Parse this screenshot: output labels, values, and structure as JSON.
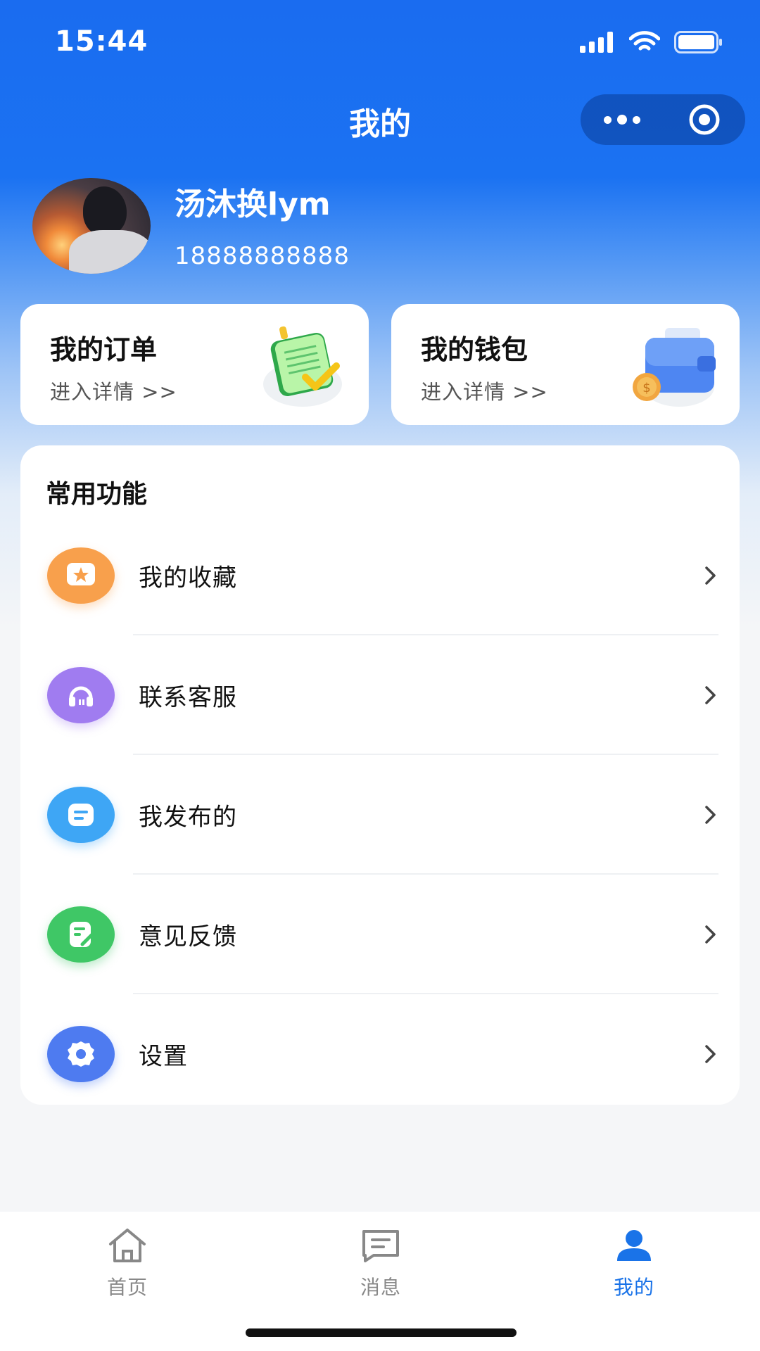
{
  "status": {
    "time": "15:44"
  },
  "nav": {
    "title": "我的"
  },
  "profile": {
    "name": "汤沐换lym",
    "phone": "18888888888"
  },
  "cards": [
    {
      "title": "我的订单",
      "subtitle": "进入详情 >>",
      "icon": "notepad-check-icon"
    },
    {
      "title": "我的钱包",
      "subtitle": "进入详情 >>",
      "icon": "wallet-coin-icon"
    }
  ],
  "functions": {
    "title": "常用功能",
    "items": [
      {
        "label": "我的收藏",
        "icon": "star-icon",
        "color": "#f8a04c"
      },
      {
        "label": "联系客服",
        "icon": "headset-icon",
        "color": "#a07cf0"
      },
      {
        "label": "我发布的",
        "icon": "message-icon",
        "color": "#3ea6f5"
      },
      {
        "label": "意见反馈",
        "icon": "feedback-icon",
        "color": "#3fc766"
      },
      {
        "label": "设置",
        "icon": "gear-icon",
        "color": "#4e7bf0"
      }
    ]
  },
  "tabbar": {
    "items": [
      {
        "label": "首页",
        "icon": "home-icon"
      },
      {
        "label": "消息",
        "icon": "chat-icon"
      },
      {
        "label": "我的",
        "icon": "user-icon"
      }
    ],
    "active": "我的"
  },
  "colors": {
    "primary": "#1a73e8",
    "header": "#1a6cf0"
  }
}
